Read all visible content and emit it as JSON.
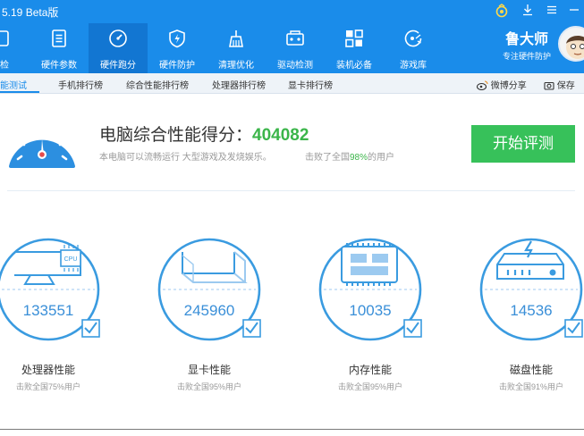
{
  "app": {
    "title": "5.19 Beta版"
  },
  "nav": [
    {
      "label": "体检",
      "icon": "checkup-icon"
    },
    {
      "label": "硬件参数",
      "icon": "document-icon"
    },
    {
      "label": "硬件跑分",
      "icon": "speedometer-icon"
    },
    {
      "label": "硬件防护",
      "icon": "shield-icon"
    },
    {
      "label": "清理优化",
      "icon": "broom-icon"
    },
    {
      "label": "驱动检测",
      "icon": "driver-icon"
    },
    {
      "label": "装机必备",
      "icon": "apps-grid-icon"
    },
    {
      "label": "游戏库",
      "icon": "game-icon"
    }
  ],
  "brand": {
    "name": "鲁大师",
    "subtitle": "专注硬件防护"
  },
  "subtabs": [
    {
      "label": "性能测试"
    },
    {
      "label": "手机排行榜"
    },
    {
      "label": "综合性能排行榜"
    },
    {
      "label": "处理器排行榜"
    },
    {
      "label": "显卡排行榜"
    }
  ],
  "share": {
    "weibo_label": "微博分享",
    "save_label": "保存"
  },
  "summary": {
    "title_prefix": "电脑综合性能得分：",
    "score": "404082",
    "description": "本电脑可以流畅运行 大型游戏及发烧娱乐。",
    "beat_prefix": "击败了全国",
    "beat_percent": "98%",
    "beat_suffix": "的用户",
    "start_button": "开始评测"
  },
  "cards": [
    {
      "value": "133551",
      "name": "处理器性能",
      "beat": "击败全国75%用户",
      "icon": "cpu-monitor-icon"
    },
    {
      "value": "245960",
      "name": "显卡性能",
      "beat": "击败全国95%用户",
      "icon": "graphics-card-icon"
    },
    {
      "value": "10035",
      "name": "内存性能",
      "beat": "击败全国95%用户",
      "icon": "memory-chip-icon"
    },
    {
      "value": "14536",
      "name": "磁盘性能",
      "beat": "击败全国91%用户",
      "icon": "hard-disk-icon"
    }
  ],
  "colors": {
    "header_bg": "#1a8cea",
    "accent_green": "#37c15a",
    "score_green": "#3bb54a",
    "ring_blue": "#3a9be0"
  }
}
